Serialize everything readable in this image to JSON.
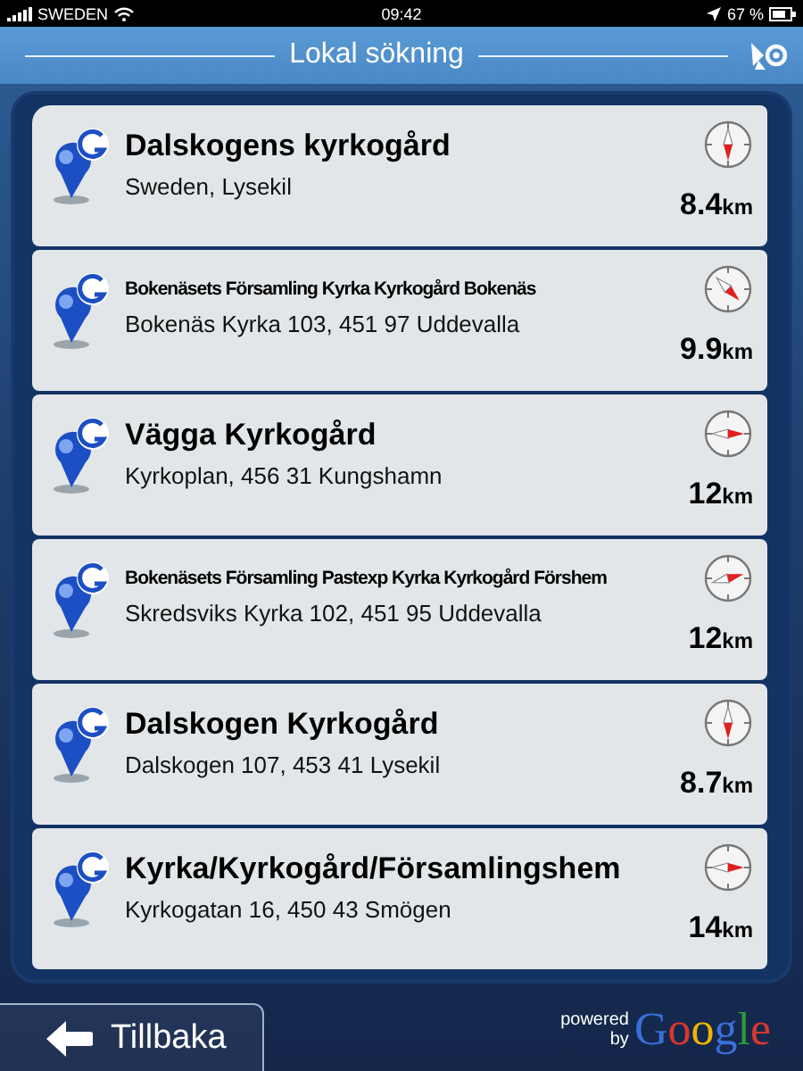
{
  "status_bar": {
    "carrier": "SWEDEN",
    "time": "09:42",
    "battery": "67 %"
  },
  "header": {
    "title": "Lokal sökning"
  },
  "results": [
    {
      "name": "Dalskogens kyrkogård",
      "condensed": false,
      "address": "Sweden, Lysekil",
      "kind": "south",
      "distance": "8.4",
      "unit": "km"
    },
    {
      "name": "Bokenäsets Församling Kyrka Kyrkogård Bokenäs",
      "condensed": true,
      "address": "Bokenäs Kyrka 103, 451 97 Uddevalla",
      "kind": "southeast",
      "distance": "9.9",
      "unit": "km"
    },
    {
      "name": "Vägga Kyrkogård",
      "condensed": false,
      "address": "Kyrkoplan, 456 31 Kungshamn",
      "kind": "east",
      "distance": "12",
      "unit": "km"
    },
    {
      "name": "Bokenäsets Församling Pastexp Kyrka Kyrkogård Förshem",
      "condensed": true,
      "address": "Skredsviks Kyrka 102, 451 95 Uddevalla",
      "kind": "eastnortheast",
      "distance": "12",
      "unit": "km"
    },
    {
      "name": "Dalskogen Kyrkogård",
      "condensed": false,
      "address": "Dalskogen 107, 453 41 Lysekil",
      "kind": "south",
      "distance": "8.7",
      "unit": "km"
    },
    {
      "name": "Kyrka/Kyrkogård/Församlingshem",
      "condensed": false,
      "address": "Kyrkogatan 16, 450 43 Smögen",
      "kind": "east",
      "distance": "14",
      "unit": "km"
    }
  ],
  "back_button": {
    "label": "Tillbaka"
  },
  "attribution": {
    "powered": "powered",
    "by": "by",
    "brand": "Google"
  }
}
